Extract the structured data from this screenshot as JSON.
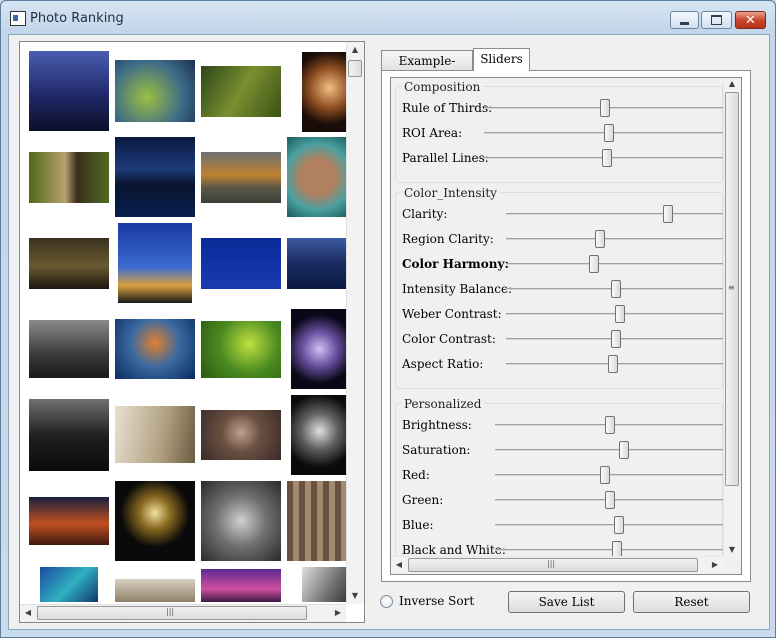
{
  "window": {
    "title": "Photo Ranking"
  },
  "window_controls": {
    "minimize": "minimize-icon",
    "maximize": "maximize-icon",
    "close": "close-icon"
  },
  "photo_list": {
    "thumbnails": [
      "night-city-skyline",
      "dragonfly-macro",
      "dragonfly-on-grass",
      "ferris-wheel-night",
      "bald-eagle",
      "capitol-at-night",
      "tiger-in-water",
      "clock-face",
      "city-lights-dusk",
      "cyclist-silhouette",
      "fireworks-text",
      "city-skyline-blue",
      "church-towers-bw",
      "water-splash-drop",
      "fly-on-leaf",
      "glowing-flower",
      "city-skyline-bw",
      "wall-hook-shadow",
      "elderly-woman-portrait",
      "flower-bw",
      "golden-gate-bridge-night",
      "flower-in-vase",
      "astronaut-child-bw",
      "old-apartment-building",
      "aerial-coast",
      "sneaker-close-up",
      "purple-sunset",
      "building-corner-bw"
    ]
  },
  "tabs": [
    {
      "label": "Example-based"
    },
    {
      "label": "Sliders"
    }
  ],
  "active_tab": "Sliders",
  "groups": [
    {
      "title": "Composition",
      "sliders": [
        {
          "label": "Rule of Thirds:",
          "value": 0.5,
          "bold": false
        },
        {
          "label": "ROI Area:",
          "value": 0.52,
          "bold": false
        },
        {
          "label": "Parallel Lines:",
          "value": 0.51,
          "bold": false
        }
      ]
    },
    {
      "title": "Color_Intensity",
      "sliders": [
        {
          "label": "Clarity:",
          "value": 0.74,
          "bold": false
        },
        {
          "label": "Region Clarity:",
          "value": 0.43,
          "bold": false
        },
        {
          "label": "Color Harmony:",
          "value": 0.4,
          "bold": true
        },
        {
          "label": "Intensity Balance:",
          "value": 0.5,
          "bold": false
        },
        {
          "label": "Weber Contrast:",
          "value": 0.52,
          "bold": false
        },
        {
          "label": "Color Contrast:",
          "value": 0.5,
          "bold": false
        },
        {
          "label": "Aspect Ratio:",
          "value": 0.49,
          "bold": false
        }
      ]
    },
    {
      "title": "Personalized",
      "sliders": [
        {
          "label": "Brightness:",
          "value": 0.5,
          "bold": false
        },
        {
          "label": "Saturation:",
          "value": 0.56,
          "bold": false
        },
        {
          "label": "Red:",
          "value": 0.48,
          "bold": false
        },
        {
          "label": "Green:",
          "value": 0.5,
          "bold": false
        },
        {
          "label": "Blue:",
          "value": 0.54,
          "bold": false
        },
        {
          "label": "Black and White:",
          "value": 0.53,
          "bold": false
        }
      ]
    }
  ],
  "options": {
    "inverse_sort_label": "Inverse Sort",
    "inverse_sort_checked": false
  },
  "buttons": {
    "save_list": "Save List",
    "reset": "Reset"
  }
}
